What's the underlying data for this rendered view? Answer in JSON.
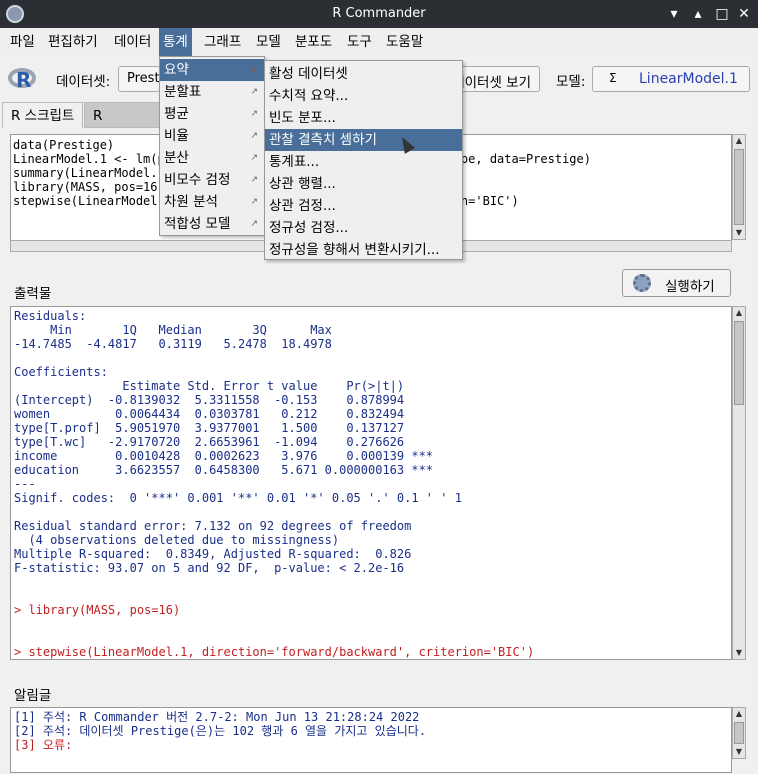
{
  "window": {
    "title": "R Commander",
    "min": "▾",
    "restore": "▴",
    "maximize": "□",
    "close": "✕"
  },
  "menubar": [
    "파일",
    "편집하기",
    "데이터",
    "통계",
    "그래프",
    "모델",
    "분포도",
    "도구",
    "도움말"
  ],
  "toolbar": {
    "dataset_label": "데이터셋:",
    "dataset_value": "Prestige",
    "view_button": "데이터셋 보기",
    "model_label": "모델:",
    "model_sigma": "Σ",
    "model_value": "LinearModel.1"
  },
  "tabs": {
    "script": "R 스크립트",
    "markdown": "R Markdown"
  },
  "script_lines": [
    "data(Prestige)",
    "LinearModel.1 <- lm(prestige ~ education + income + women + type, data=Prestige)",
    "summary(LinearModel.1)",
    "library(MASS, pos=16)",
    "stepwise(LinearModel.1, direction='forward/backward', criterion='BIC')"
  ],
  "run_button": "실행하기",
  "output_label": "출력물",
  "output_lines": [
    {
      "t": "Residuals:",
      "cmd": false
    },
    {
      "t": "     Min       1Q   Median       3Q      Max",
      "cmd": false
    },
    {
      "t": "-14.7485  -4.4817   0.3119   5.2478  18.4978",
      "cmd": false
    },
    {
      "t": "",
      "cmd": false
    },
    {
      "t": "Coefficients:",
      "cmd": false
    },
    {
      "t": "               Estimate Std. Error t value    Pr(>|t|)",
      "cmd": false
    },
    {
      "t": "(Intercept)  -0.8139032  5.3311558  -0.153    0.878994",
      "cmd": false
    },
    {
      "t": "women         0.0064434  0.0303781   0.212    0.832494",
      "cmd": false
    },
    {
      "t": "type[T.prof]  5.9051970  3.9377001   1.500    0.137127",
      "cmd": false
    },
    {
      "t": "type[T.wc]   -2.9170720  2.6653961  -1.094    0.276626",
      "cmd": false
    },
    {
      "t": "income        0.0010428  0.0002623   3.976    0.000139 ***",
      "cmd": false
    },
    {
      "t": "education     3.6623557  0.6458300   5.671 0.000000163 ***",
      "cmd": false
    },
    {
      "t": "---",
      "cmd": false
    },
    {
      "t": "Signif. codes:  0 '***' 0.001 '**' 0.01 '*' 0.05 '.' 0.1 ' ' 1",
      "cmd": false
    },
    {
      "t": "",
      "cmd": false
    },
    {
      "t": "Residual standard error: 7.132 on 92 degrees of freedom",
      "cmd": false
    },
    {
      "t": "  (4 observations deleted due to missingness)",
      "cmd": false
    },
    {
      "t": "Multiple R-squared:  0.8349, Adjusted R-squared:  0.826",
      "cmd": false
    },
    {
      "t": "F-statistic: 93.07 on 5 and 92 DF,  p-value: < 2.2e-16",
      "cmd": false
    },
    {
      "t": "",
      "cmd": false
    },
    {
      "t": "",
      "cmd": false
    },
    {
      "t": "> library(MASS, pos=16)",
      "cmd": true
    },
    {
      "t": "",
      "cmd": false
    },
    {
      "t": "",
      "cmd": false
    },
    {
      "t": "> stepwise(LinearModel.1, direction='forward/backward', criterion='BIC')",
      "cmd": true
    }
  ],
  "messages_label": "알림글",
  "message_lines": [
    {
      "t": "[1] 주석: R Commander 버전 2.7-2: Mon Jun 13 21:28:24 2022",
      "c": "#1a2f8a"
    },
    {
      "t": "[2] 주석: 데이터셋 Prestige(은)는 102 행과 6 열을 가지고 있습니다.",
      "c": "#1a2f8a"
    },
    {
      "t": "[3] 오류:",
      "c": "#c02020"
    }
  ],
  "stats_menu": [
    "요약",
    "분할표",
    "평균",
    "비율",
    "분산",
    "비모수 검정",
    "차원 분석",
    "적합성 모델"
  ],
  "summary_submenu": [
    "활성 데이터셋",
    "수치적 요약...",
    "빈도 분포...",
    "관찰 결측치 셈하기",
    "통계표...",
    "상관 행렬...",
    "상관 검정...",
    "정규성 검정...",
    "정규성을 향해서 변환시키기..."
  ],
  "colors": {
    "highlight": "#4a6e9a",
    "output_text": "#1a2f8a",
    "command_text": "#c02020"
  }
}
